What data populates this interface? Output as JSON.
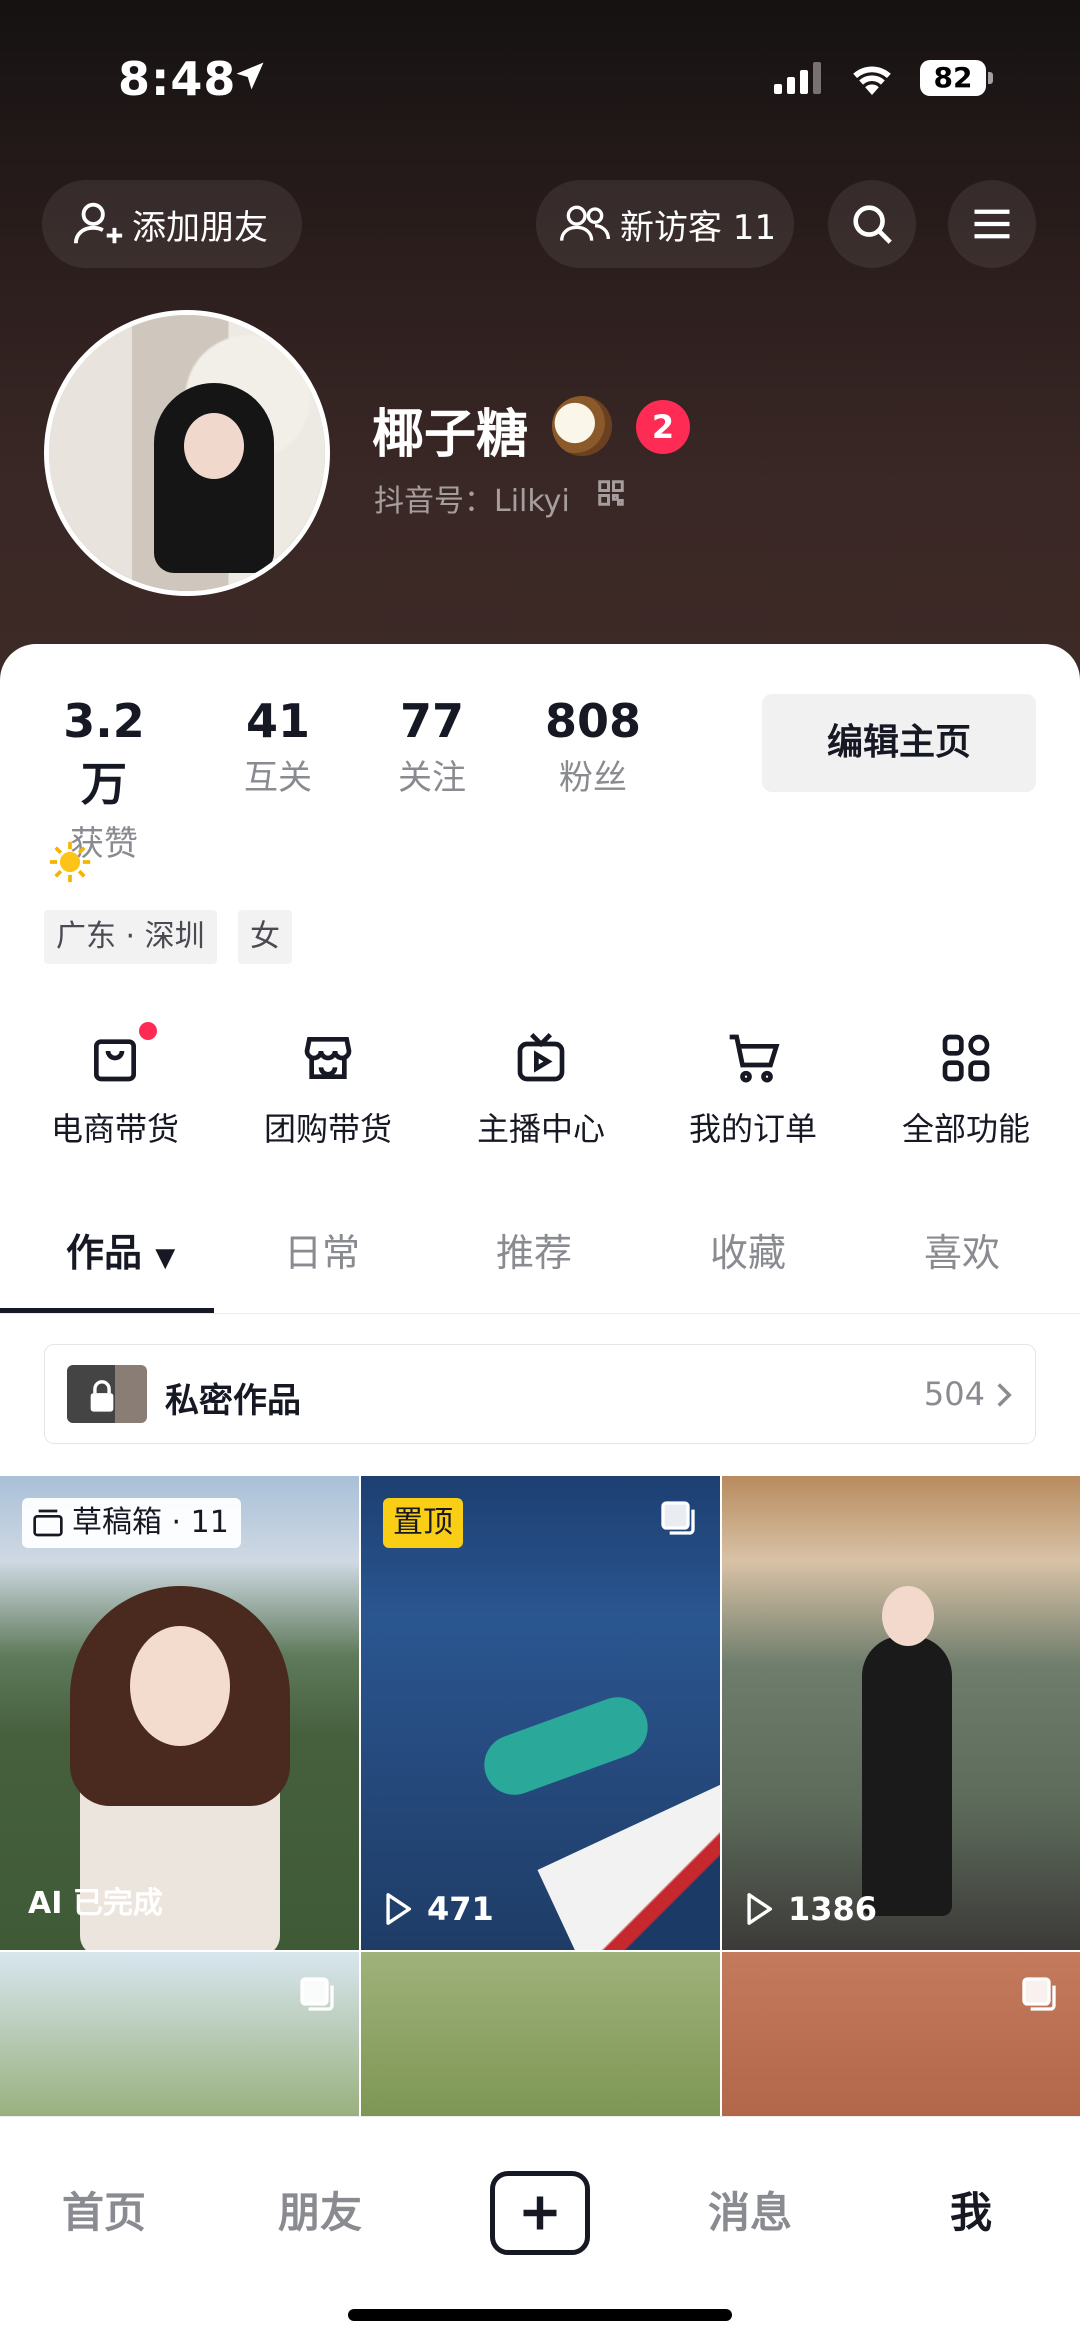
{
  "status_bar": {
    "time": "8:48",
    "battery": "82"
  },
  "header": {
    "add_friend_label": "添加朋友",
    "visitors_label": "新访客 11"
  },
  "profile": {
    "name": "椰子糖",
    "notification_count": "2",
    "douyin_id": "抖音号：Lilkyi"
  },
  "stats": [
    {
      "value": "3.2万",
      "label": "获赞"
    },
    {
      "value": "41",
      "label": "互关"
    },
    {
      "value": "77",
      "label": "关注"
    },
    {
      "value": "808",
      "label": "粉丝"
    }
  ],
  "edit_button": "编辑主页",
  "tags": [
    "广东 · 深圳",
    "女"
  ],
  "features": [
    {
      "label": "电商带货",
      "icon": "shopping-bag-icon"
    },
    {
      "label": "团购带货",
      "icon": "store-icon"
    },
    {
      "label": "主播中心",
      "icon": "tv-play-icon"
    },
    {
      "label": "我的订单",
      "icon": "cart-icon"
    },
    {
      "label": "全部功能",
      "icon": "grid-apps-icon"
    }
  ],
  "tabs": [
    "作品",
    "日常",
    "推荐",
    "收藏",
    "喜欢"
  ],
  "private_works": {
    "label": "私密作品",
    "count": "504"
  },
  "grid": [
    {
      "badge": "草稿箱 · 11",
      "caption": "AI 已完成"
    },
    {
      "badge": "置顶",
      "plays": "471"
    },
    {
      "plays": "1386"
    }
  ],
  "bottom_nav": [
    "首页",
    "朋友",
    "消息",
    "我"
  ],
  "colors": {
    "accent_red": "#fe2c55",
    "pinned_yellow": "#face15",
    "text_dark": "#161823",
    "text_gray": "#8a8b91"
  }
}
